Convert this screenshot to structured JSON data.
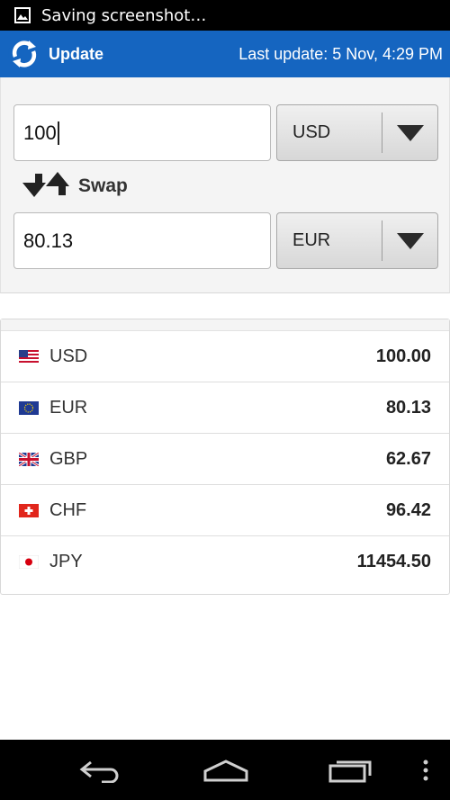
{
  "status_bar": {
    "notification_text": "Saving screenshot…",
    "icon": "image-icon"
  },
  "action_bar": {
    "update_label": "Update",
    "last_update": "Last update: 5 Nov, 4:29 PM",
    "accent_color": "#1565c0"
  },
  "converter": {
    "from_amount": "100",
    "from_currency": "USD",
    "swap_label": "Swap",
    "to_amount": "80.13",
    "to_currency": "EUR"
  },
  "rates": [
    {
      "code": "USD",
      "value": "100.00",
      "flag": "us-flag-icon"
    },
    {
      "code": "EUR",
      "value": "80.13",
      "flag": "eu-flag-icon"
    },
    {
      "code": "GBP",
      "value": "62.67",
      "flag": "uk-flag-icon"
    },
    {
      "code": "CHF",
      "value": "96.42",
      "flag": "swiss-flag-icon"
    },
    {
      "code": "JPY",
      "value": "11454.50",
      "flag": "japan-flag-icon"
    }
  ],
  "nav_bar": {
    "buttons": [
      "back-icon",
      "home-icon",
      "recents-icon",
      "menu-icon"
    ]
  }
}
